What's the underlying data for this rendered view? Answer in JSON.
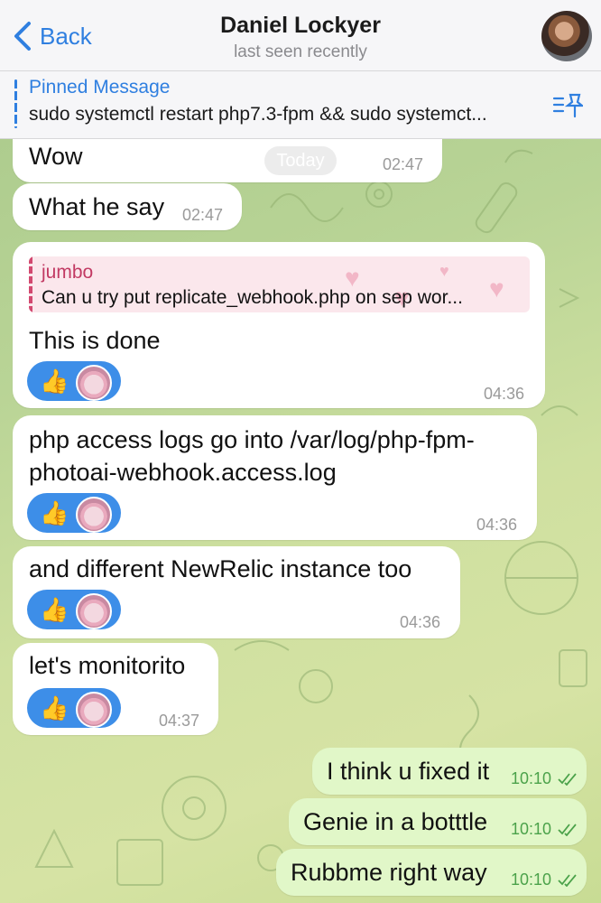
{
  "header": {
    "back_label": "Back",
    "title": "Daniel Lockyer",
    "subtitle": "last seen recently"
  },
  "pinned": {
    "title": "Pinned Message",
    "text": "sudo systemctl restart php7.3-fpm && sudo systemct..."
  },
  "date_pill": "Today",
  "messages": [
    {
      "text": "Wow",
      "time": "02:47"
    },
    {
      "text": "What he say",
      "time": "02:47"
    },
    {
      "reply": {
        "name": "jumbo",
        "text": "Can u try put replicate_webhook.php on sep wor..."
      },
      "text": "This is done",
      "time": "04:36",
      "reactions": [
        "thumbs-up",
        "axolotl-avatar"
      ]
    },
    {
      "text": "php access logs go into /var/log/php-fpm-",
      "text2": "photoai-webhook.access.log",
      "time": "04:36",
      "reactions": [
        "thumbs-up",
        "axolotl-avatar"
      ]
    },
    {
      "text": "and different NewRelic instance too",
      "time": "04:36",
      "reactions": [
        "thumbs-up",
        "axolotl-avatar"
      ]
    },
    {
      "text": "let's monitorito",
      "time": "04:37",
      "reactions": [
        "thumbs-up",
        "axolotl-avatar"
      ]
    }
  ],
  "outgoing": [
    {
      "text": "I think u fixed it",
      "time": "10:10"
    },
    {
      "text": "Genie in a botttle",
      "time": "10:10"
    },
    {
      "text": "Rubbme right way",
      "time": "10:10"
    }
  ],
  "colors": {
    "accent": "#2f7fe0",
    "reaction_bg": "#3d8ee8",
    "outgoing_bubble": "#e1f7c8",
    "reply_name": "#c23a63"
  }
}
